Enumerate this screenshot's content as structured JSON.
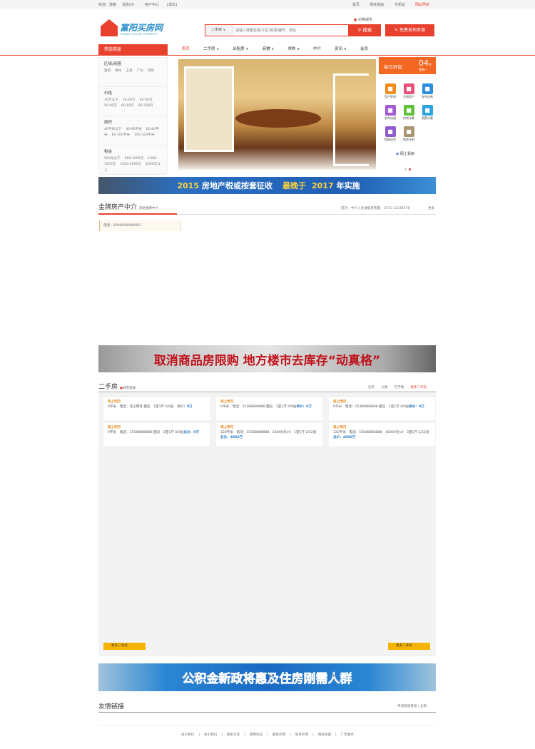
{
  "topbar": {
    "welcome": "欢迎：游客",
    "messages": "消息(0)",
    "user_center": "用户中心",
    "logout": "[退出]",
    "home": "首页",
    "favorite": "保存桌面",
    "mobile": "手机站",
    "sitemap": "网站导航"
  },
  "header": {
    "logo_cn": "富阳买房网",
    "logo_en": "FUYANG HOUSE PROPERTY",
    "location": "切换城市",
    "search_type": "二手房",
    "search_placeholder": "请输入楼盘名称/小区/房源/编号、地址",
    "search_button": "搜索",
    "publish_button": "免费发布房源"
  },
  "nav": {
    "filter_title": "筛选楼盘",
    "items": [
      "首页",
      "二手房 ∨",
      "出租房 ∨",
      "商铺 ∨",
      "求购 ∨",
      "中介",
      "资讯 ∨",
      "会员"
    ]
  },
  "filters": [
    {
      "title": "区域/商圈",
      "options": [
        "富阳",
        "杭州",
        "上海",
        "广州",
        "深圳"
      ]
    },
    {
      "title": "价格",
      "options": [
        "10万以下",
        "10-40万",
        "40-50万",
        "50-60万",
        "60-80万",
        "80-100万"
      ]
    },
    {
      "title": "面积",
      "options": [
        "40平米以下",
        "40-60平米",
        "60-80平米",
        "80-100平米",
        "100-120平米"
      ]
    },
    {
      "title": "租金",
      "options": [
        "500元以下",
        "600-1000元",
        "1000-1500元",
        "1500-2000元",
        "2000元以上"
      ]
    }
  ],
  "daily": {
    "title": "每日好房",
    "day": "04",
    "unit": "号",
    "weekday": "星期一",
    "tools": [
      {
        "label": "用户登录",
        "icon": "users-icon",
        "color": "#f28c1f"
      },
      {
        "label": "注册用户",
        "icon": "user-add-icon",
        "color": "#e8507a"
      },
      {
        "label": "发布出售",
        "icon": "home-icon",
        "color": "#2d8ee0"
      },
      {
        "label": "发布出租",
        "icon": "lock-icon",
        "color": "#a35bd1"
      },
      {
        "label": "房贷计算",
        "icon": "chart-icon",
        "color": "#5ec23a"
      },
      {
        "label": "税费计算",
        "icon": "calculator-icon",
        "color": "#2ba3e0"
      },
      {
        "label": "提前还贷",
        "icon": "money-bag-icon",
        "color": "#8e5bd1"
      },
      {
        "label": "购房计划",
        "icon": "list-icon",
        "color": "#a89570"
      }
    ],
    "link": "网上看房"
  },
  "banners": {
    "b1_a": "2015",
    "b1_b": "房地产税或按套征收",
    "b1_c": "最晚于",
    "b1_d": "2017",
    "b1_e": "年实施",
    "b2": "取消商品房限购 地方楼市去库存“动真格”",
    "b3": "公积金新政将惠及住房刚需人群"
  },
  "agency": {
    "title": "金牌房产中介",
    "subtitle": "某地金牌中介",
    "notice": "提示：中介入驻请联系客服：0571-12345678",
    "more": "更多",
    "note": "电话：0000000000000"
  },
  "second": {
    "title": "二手房",
    "location": "城市选择",
    "tabs": [
      "住宅",
      "公寓",
      "写字楼",
      "更多二手房"
    ],
    "cards": [
      {
        "title": "海上明月",
        "line": "0平米　电话：海上明月 面议　1室1厅 0/0层　单价",
        "price": "：0万"
      },
      {
        "title": "海上明月",
        "line": "0平米　电话：15388888888 面议　1室1厅 0/0层",
        "price": "单价：0万"
      },
      {
        "title": "海上明月",
        "line": "0平米　电话：15388888888 面议　1室1厅 0/0层",
        "price": "单价：0万"
      },
      {
        "title": "海上明月",
        "line": "0平米　电话：15588888888 面议　2室1厅 0/0层",
        "price": "总价：0万"
      },
      {
        "title": "海上明月",
        "line": "120平米　电话：15588888888　16000元/㎡　1室1厅 2/22层",
        "price": "总价：4800万"
      },
      {
        "title": "海上明月",
        "line": "120平米　电话：15588888888　16000元/㎡　3室1厅 2/22层",
        "price": "总价：4800万"
      }
    ],
    "more_button": "更多二手房 ..."
  },
  "links": {
    "title": "友情链接",
    "apply": "申请友情链接",
    "all": "全部"
  },
  "footer": [
    "关于我们",
    "关于我们",
    "联系方式",
    "使用协议",
    "版权声明",
    "免责声明",
    "网站地图",
    "广告服务"
  ]
}
